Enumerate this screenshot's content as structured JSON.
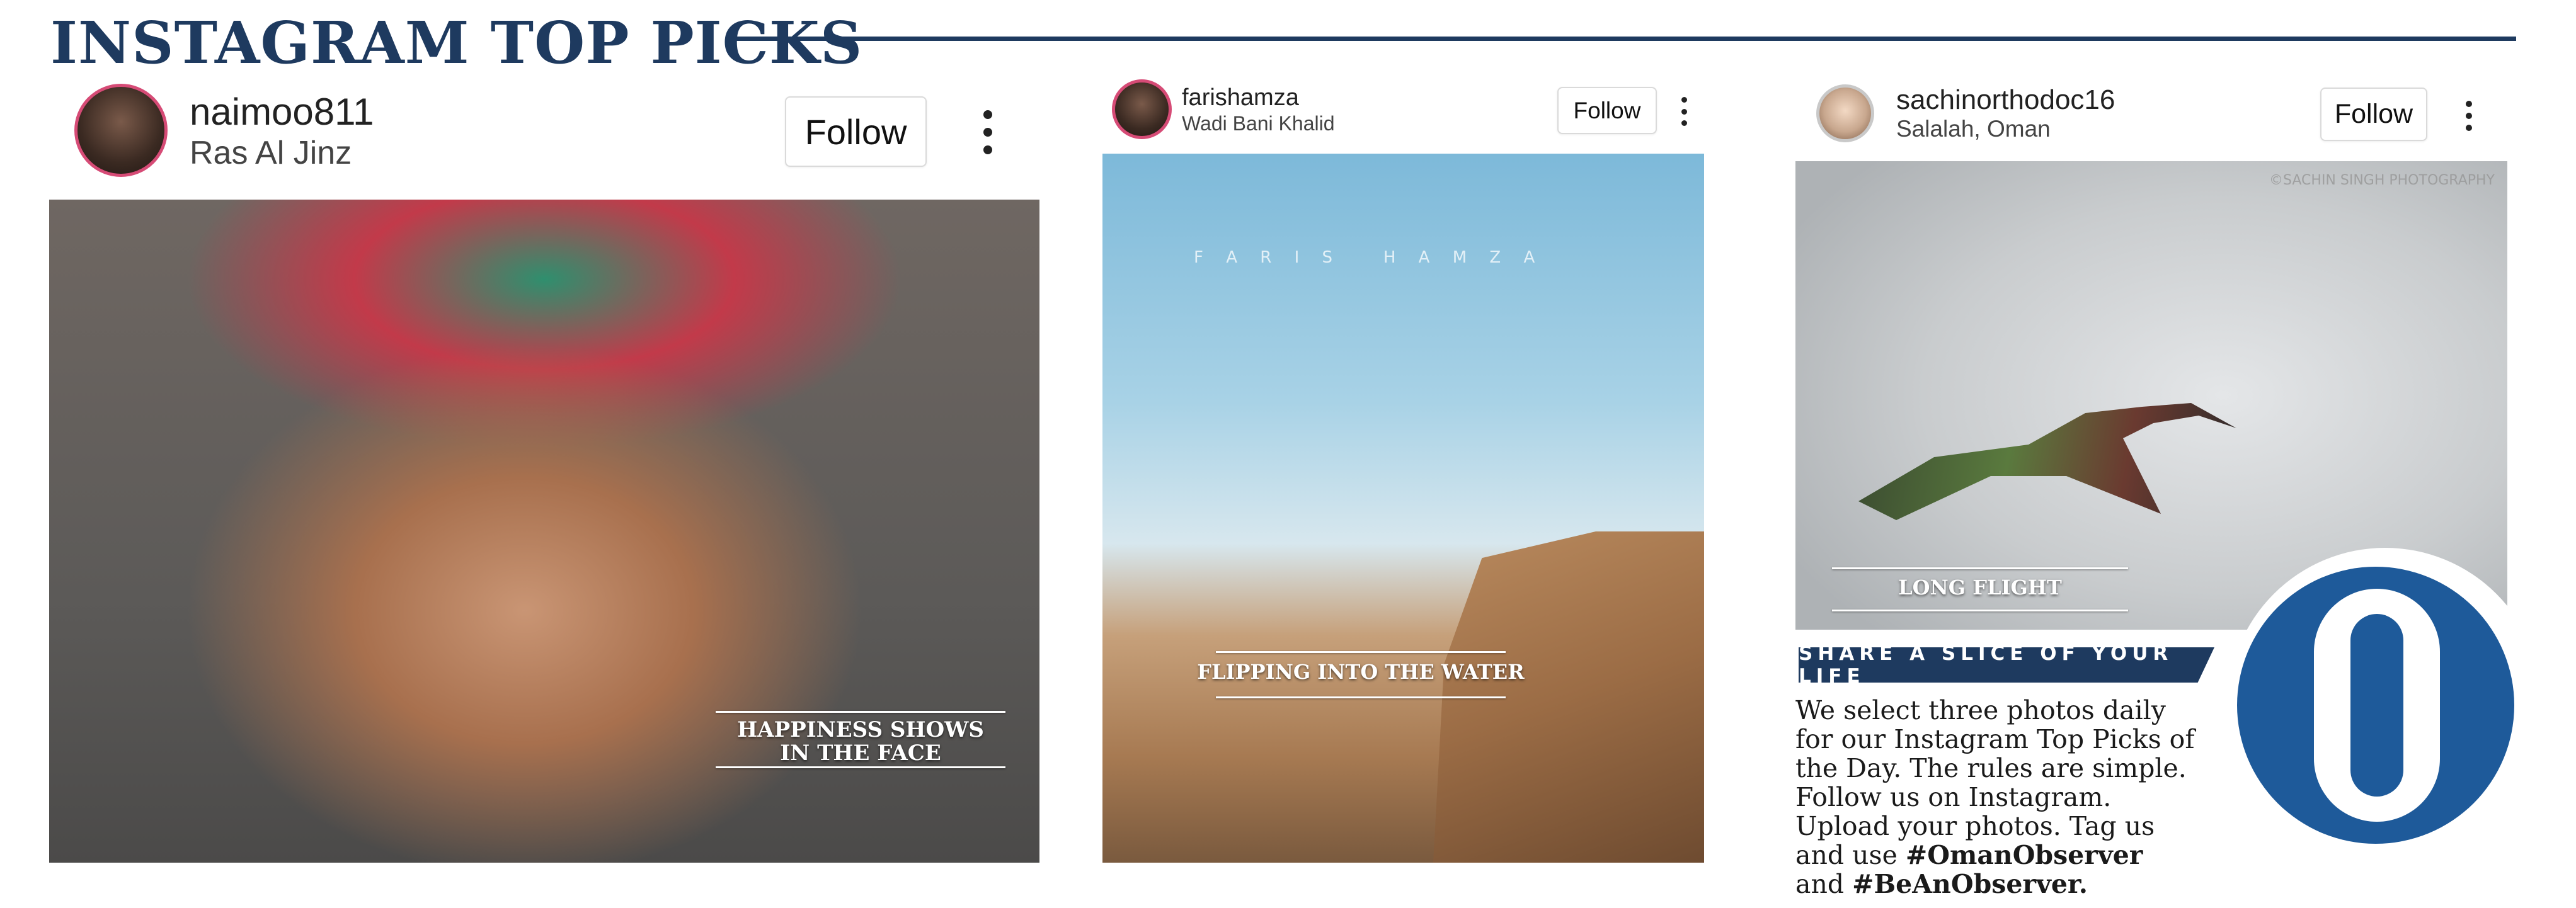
{
  "header": {
    "title": "INSTAGRAM TOP PICKS"
  },
  "posts": [
    {
      "username": "naimoo811",
      "location": "Ras Al Jinz",
      "follow_label": "Follow",
      "caption": [
        "HAPPINESS SHOWS",
        "IN THE FACE"
      ]
    },
    {
      "username": "farishamza",
      "location": "Wadi Bani Khalid",
      "follow_label": "Follow",
      "caption": [
        "FLIPPING INTO THE WATER"
      ],
      "overlay_text": "F A R I S   H A M Z A"
    },
    {
      "username": "sachinorthodoc16",
      "location": "Salalah, Oman",
      "follow_label": "Follow",
      "caption": [
        "LONG FLIGHT"
      ],
      "watermark": "©SACHIN SINGH PHOTOGRAPHY"
    }
  ],
  "info": {
    "banner": "SHARE A SLICE OF YOUR LIFE",
    "body": "We select three photos daily for our Instagram Top Picks of the Day. The rules are simple. Follow us on Instagram. Upload your photos. Tag us and use",
    "hashtag1": "#OmanObserver",
    "connector": "and",
    "hashtag2": "#BeAnObserver."
  },
  "colors": {
    "navy": "#1e3a5f",
    "logo_blue": "#1e5a9a"
  }
}
